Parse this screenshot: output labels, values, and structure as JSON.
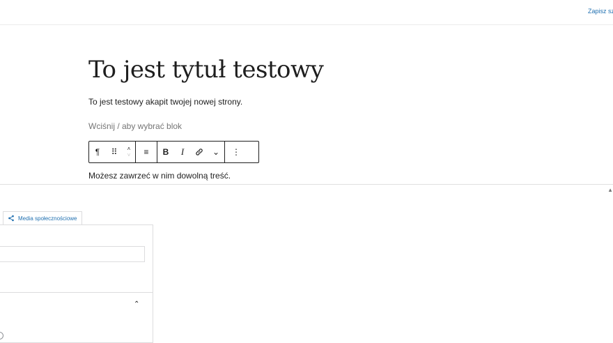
{
  "topbar": {
    "save_draft_label": "Zapisz szkic"
  },
  "editor": {
    "title": "To jest tytuł testowy",
    "paragraph_1": "To jest testowy akapit twojej nowej strony.",
    "placeholder": "Wciśnij / aby wybrać blok",
    "paragraph_2": "Możesz zawrzeć w nim dowolną treść."
  },
  "toolbar": {
    "paragraph_glyph": "¶",
    "drag_glyph": "⠿",
    "move_up_glyph": "˄",
    "move_down_glyph": "˅",
    "align_glyph": "≡",
    "bold_glyph": "B",
    "italic_glyph": "I",
    "more_rich_glyph": "⌄",
    "options_glyph": "⋮"
  },
  "panel": {
    "toggle_glyph": "▲",
    "social_tab_label": "Media społecznościowe",
    "chevron_glyph": "⌃"
  }
}
